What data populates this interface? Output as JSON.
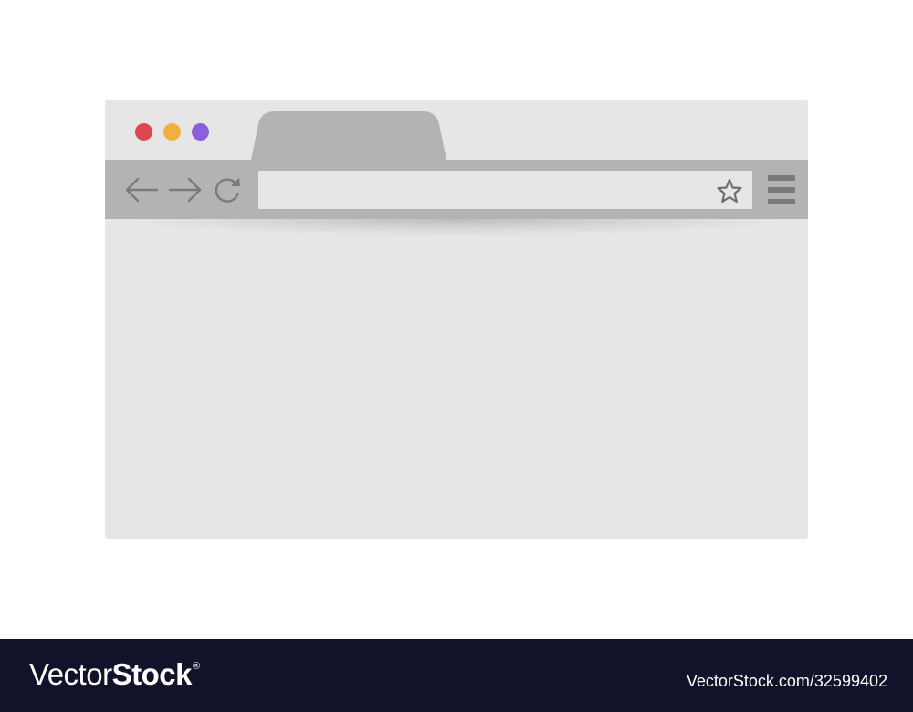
{
  "window": {
    "traffic_lights": [
      {
        "name": "close",
        "color": "#e0474c"
      },
      {
        "name": "minimize",
        "color": "#f0b23c"
      },
      {
        "name": "zoom",
        "color": "#8a5fe0"
      }
    ],
    "tab": {
      "label": "",
      "color": "#b3b3b3"
    },
    "toolbar": {
      "color": "#b3b3b3",
      "back_icon": "arrow-left-icon",
      "forward_icon": "arrow-right-icon",
      "reload_icon": "reload-icon",
      "menu_icon": "hamburger-menu-icon"
    },
    "address_bar": {
      "value": "",
      "placeholder": "",
      "bookmark_icon": "star-icon"
    },
    "content": {
      "color": "#e6e6e6"
    }
  },
  "watermark": {
    "logo_light": "Vector",
    "logo_bold": "Stock",
    "logo_mark": "®",
    "image_id": "VectorStock.com/32599402"
  }
}
